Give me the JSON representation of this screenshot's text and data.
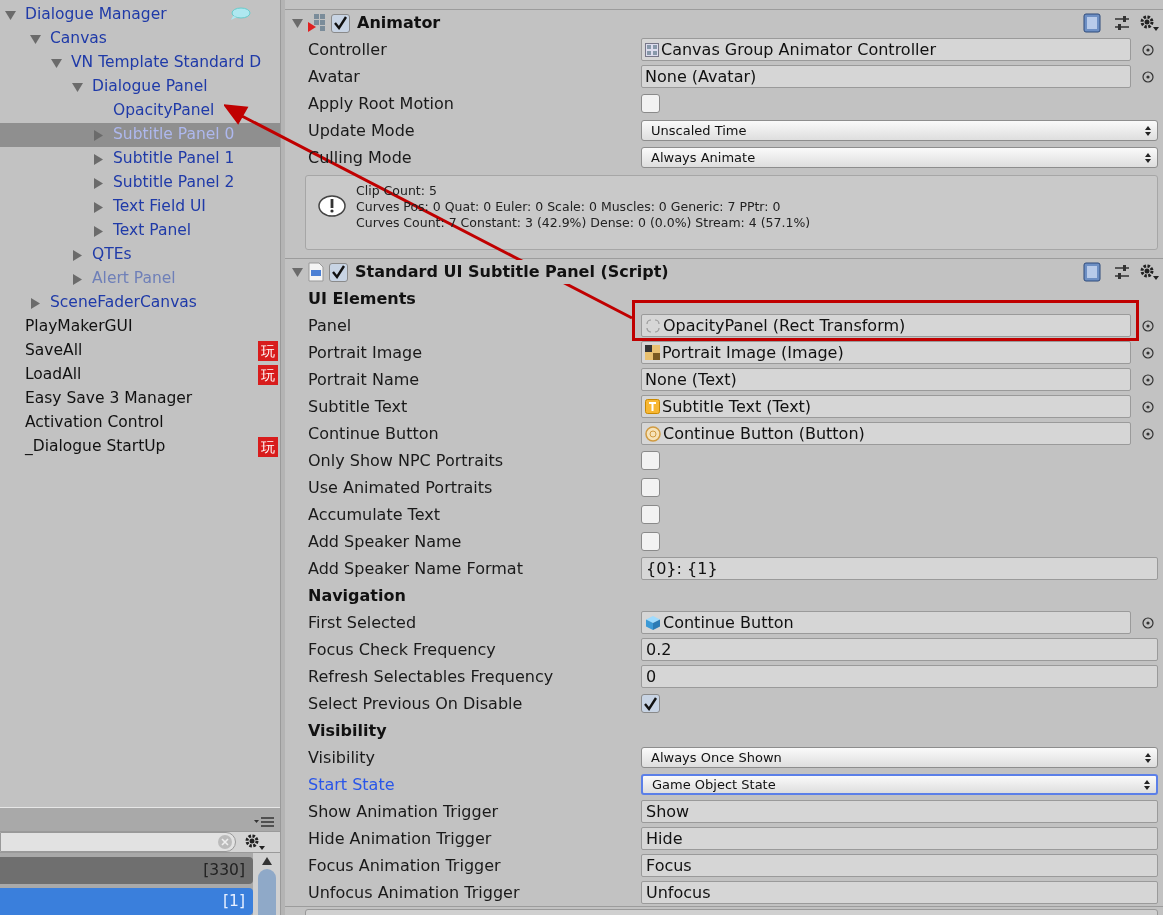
{
  "hierarchy": {
    "items": [
      {
        "label": "Dialogue Manager",
        "kind": "prefab",
        "expanded": true,
        "selected": false,
        "children": [
          {
            "label": "Canvas",
            "kind": "prefab",
            "expanded": true,
            "selected": false,
            "children": [
              {
                "label": "VN Template Standard D",
                "kind": "prefab",
                "expanded": true,
                "selected": false,
                "children": [
                  {
                    "label": "Dialogue Panel",
                    "kind": "prefab",
                    "expanded": true,
                    "selected": false,
                    "children": [
                      {
                        "label": "OpacityPanel",
                        "kind": "prefab",
                        "selected": false
                      },
                      {
                        "label": "Subtitle Panel 0",
                        "kind": "prefab",
                        "expanded": false,
                        "selected": true
                      },
                      {
                        "label": "Subtitle Panel 1",
                        "kind": "prefab",
                        "expanded": false,
                        "selected": false
                      },
                      {
                        "label": "Subtitle Panel 2",
                        "kind": "prefab",
                        "expanded": false,
                        "selected": false
                      },
                      {
                        "label": "Text Field UI",
                        "kind": "prefab",
                        "expanded": false,
                        "selected": false
                      },
                      {
                        "label": "Text Panel",
                        "kind": "prefab",
                        "expanded": false,
                        "selected": false
                      }
                    ]
                  },
                  {
                    "label": "QTEs",
                    "kind": "prefab",
                    "expanded": false,
                    "selected": false
                  },
                  {
                    "label": "Alert Panel",
                    "kind": "inactive",
                    "expanded": false,
                    "selected": false
                  }
                ]
              }
            ]
          },
          {
            "label": "SceneFaderCanvas",
            "kind": "prefab",
            "expanded": false,
            "selected": false
          }
        ]
      },
      {
        "label": "PlayMakerGUI",
        "kind": "object",
        "selected": false
      },
      {
        "label": "SaveAll",
        "kind": "object",
        "badge": "玩",
        "selected": false
      },
      {
        "label": "LoadAll",
        "kind": "object",
        "badge": "玩",
        "selected": false
      },
      {
        "label": "Easy Save 3 Manager",
        "kind": "object",
        "selected": false
      },
      {
        "label": "Activation Control",
        "kind": "object",
        "selected": false
      },
      {
        "label": "_Dialogue StartUp",
        "kind": "object",
        "badge": "玩",
        "selected": false
      }
    ]
  },
  "project": {
    "rows": [
      {
        "count": "[330]",
        "selected": false
      },
      {
        "count": "[1]",
        "selected": true
      }
    ]
  },
  "inspector": {
    "components": [
      {
        "title": "Animator",
        "enabled": true,
        "expanded": true,
        "rows": [
          {
            "kind": "object",
            "label": "Controller",
            "value": "Canvas Group Animator Controller",
            "focused": false
          },
          {
            "kind": "object",
            "label": "Avatar",
            "value": "None (Avatar)",
            "focused": false
          },
          {
            "kind": "checkbox",
            "label": "Apply Root Motion",
            "checked": false,
            "focused": false
          },
          {
            "kind": "dropdown",
            "label": "Update Mode",
            "value": "Unscaled Time",
            "focused": false
          },
          {
            "kind": "dropdown",
            "label": "Culling Mode",
            "value": "Always Animate",
            "focused": false
          },
          {
            "kind": "info",
            "lines": [
              "Clip Count: 5",
              "Curves Pos: 0 Quat: 0 Euler: 0 Scale: 0 Muscles: 0 Generic: 7 PPtr: 0",
              "Curves Count: 7 Constant: 3 (42.9%) Dense: 0 (0.0%) Stream: 4 (57.1%)"
            ]
          }
        ]
      },
      {
        "title": "Standard UI Subtitle Panel (Script)",
        "enabled": true,
        "expanded": true,
        "rows": [
          {
            "kind": "header",
            "label": "UI Elements"
          },
          {
            "kind": "object",
            "label": "Panel",
            "value": "OpacityPanel (Rect Transform)",
            "focused": false
          },
          {
            "kind": "object",
            "label": "Portrait Image",
            "value": "Portrait Image (Image)",
            "focused": false
          },
          {
            "kind": "object",
            "label": "Portrait Name",
            "value": "None (Text)",
            "focused": false
          },
          {
            "kind": "object",
            "label": "Subtitle Text",
            "value": "Subtitle Text (Text)",
            "focused": false
          },
          {
            "kind": "object",
            "label": "Continue Button",
            "value": "Continue Button (Button)",
            "focused": false
          },
          {
            "kind": "checkbox",
            "label": "Only Show NPC Portraits",
            "checked": false,
            "focused": false
          },
          {
            "kind": "checkbox",
            "label": "Use Animated Portraits",
            "checked": false,
            "focused": false
          },
          {
            "kind": "checkbox",
            "label": "Accumulate Text",
            "checked": false,
            "focused": false
          },
          {
            "kind": "checkbox",
            "label": "Add Speaker Name",
            "checked": false,
            "focused": false
          },
          {
            "kind": "text",
            "label": "Add Speaker Name Format",
            "value": "{0}: {1}",
            "focused": false
          },
          {
            "kind": "header",
            "label": "Navigation"
          },
          {
            "kind": "object",
            "label": "First Selected",
            "value": "Continue Button",
            "focused": false
          },
          {
            "kind": "text",
            "label": "Focus Check Frequency",
            "value": "0.2",
            "focused": false
          },
          {
            "kind": "text",
            "label": "Refresh Selectables Frequency",
            "value": "0",
            "focused": false
          },
          {
            "kind": "checkbox",
            "label": "Select Previous On Disable",
            "checked": true,
            "focused": false
          },
          {
            "kind": "header",
            "label": "Visibility"
          },
          {
            "kind": "dropdown",
            "label": "Visibility",
            "value": "Always Once Shown",
            "focused": false
          },
          {
            "kind": "dropdown",
            "label": "Start State",
            "value": "Game Object State",
            "focused": true
          },
          {
            "kind": "text",
            "label": "Show Animation Trigger",
            "value": "Show",
            "focused": false
          },
          {
            "kind": "text",
            "label": "Hide Animation Trigger",
            "value": "Hide",
            "focused": false
          },
          {
            "kind": "text",
            "label": "Focus Animation Trigger",
            "value": "Focus",
            "focused": false
          },
          {
            "kind": "text",
            "label": "Unfocus Animation Trigger",
            "value": "Unfocus",
            "focused": false
          }
        ]
      }
    ]
  }
}
